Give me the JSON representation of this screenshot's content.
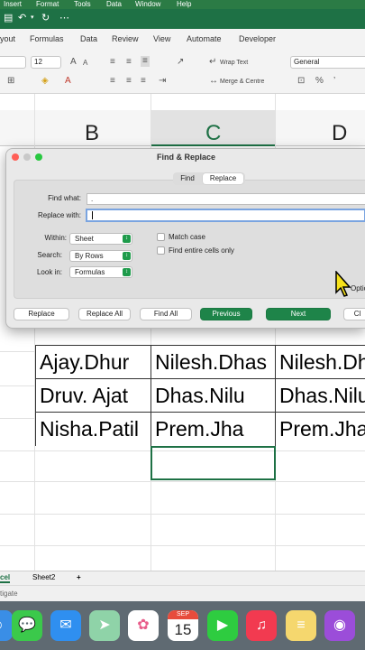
{
  "menubar": {
    "items": [
      "Insert",
      "Format",
      "Tools",
      "Data",
      "Window",
      "Help"
    ]
  },
  "ribbon_tabs": [
    "yout",
    "Formulas",
    "Data",
    "Review",
    "View",
    "Automate",
    "Developer"
  ],
  "ribbon": {
    "font_size": "12",
    "wrap_text": "Wrap Text",
    "merge_centre": "Merge & Centre",
    "number_format": "General"
  },
  "columns": [
    {
      "letter": "B"
    },
    {
      "letter": "C"
    },
    {
      "letter": "D"
    }
  ],
  "rows": [
    [
      "Ajay.Dhur",
      "Nilesh.Dhas",
      "Nilesh.Dh"
    ],
    [
      "Druv. Ajat",
      "Dhas.Nilu",
      "Dhas.Nilu"
    ],
    [
      "Nisha.Patil",
      "Prem.Jha",
      "Prem.Jha"
    ]
  ],
  "sheet_tabs": [
    "cel",
    "Sheet2",
    "+"
  ],
  "status_text": "tigate",
  "dialog": {
    "title": "Find & Replace",
    "tabs": {
      "find": "Find",
      "replace": "Replace",
      "active": "Replace"
    },
    "find_what_label": "Find what:",
    "find_what_value": ".",
    "replace_with_label": "Replace with:",
    "replace_with_value": "",
    "within_label": "Within:",
    "within_value": "Sheet",
    "search_label": "Search:",
    "search_value": "By Rows",
    "look_in_label": "Look in:",
    "look_in_value": "Formulas",
    "match_case": "Match case",
    "entire_cells": "Find entire cells only",
    "options_partial": "Optio",
    "buttons": {
      "replace": "Replace",
      "replace_all": "Replace All",
      "find_all": "Find All",
      "previous": "Previous",
      "next": "Next",
      "close_partial": "Cl"
    }
  },
  "dock": {
    "calendar_month": "SEP",
    "calendar_day": "15",
    "apps": [
      "finder-icon",
      "messages-icon",
      "mail-icon",
      "maps-icon",
      "photos-icon",
      "calendar-icon",
      "facetime-icon",
      "music-icon",
      "notes-icon",
      "podcasts-icon"
    ]
  },
  "colors": {
    "excel_green": "#1e7145",
    "button_green": "#1e8449",
    "dock_bg": "#5f6a72"
  }
}
